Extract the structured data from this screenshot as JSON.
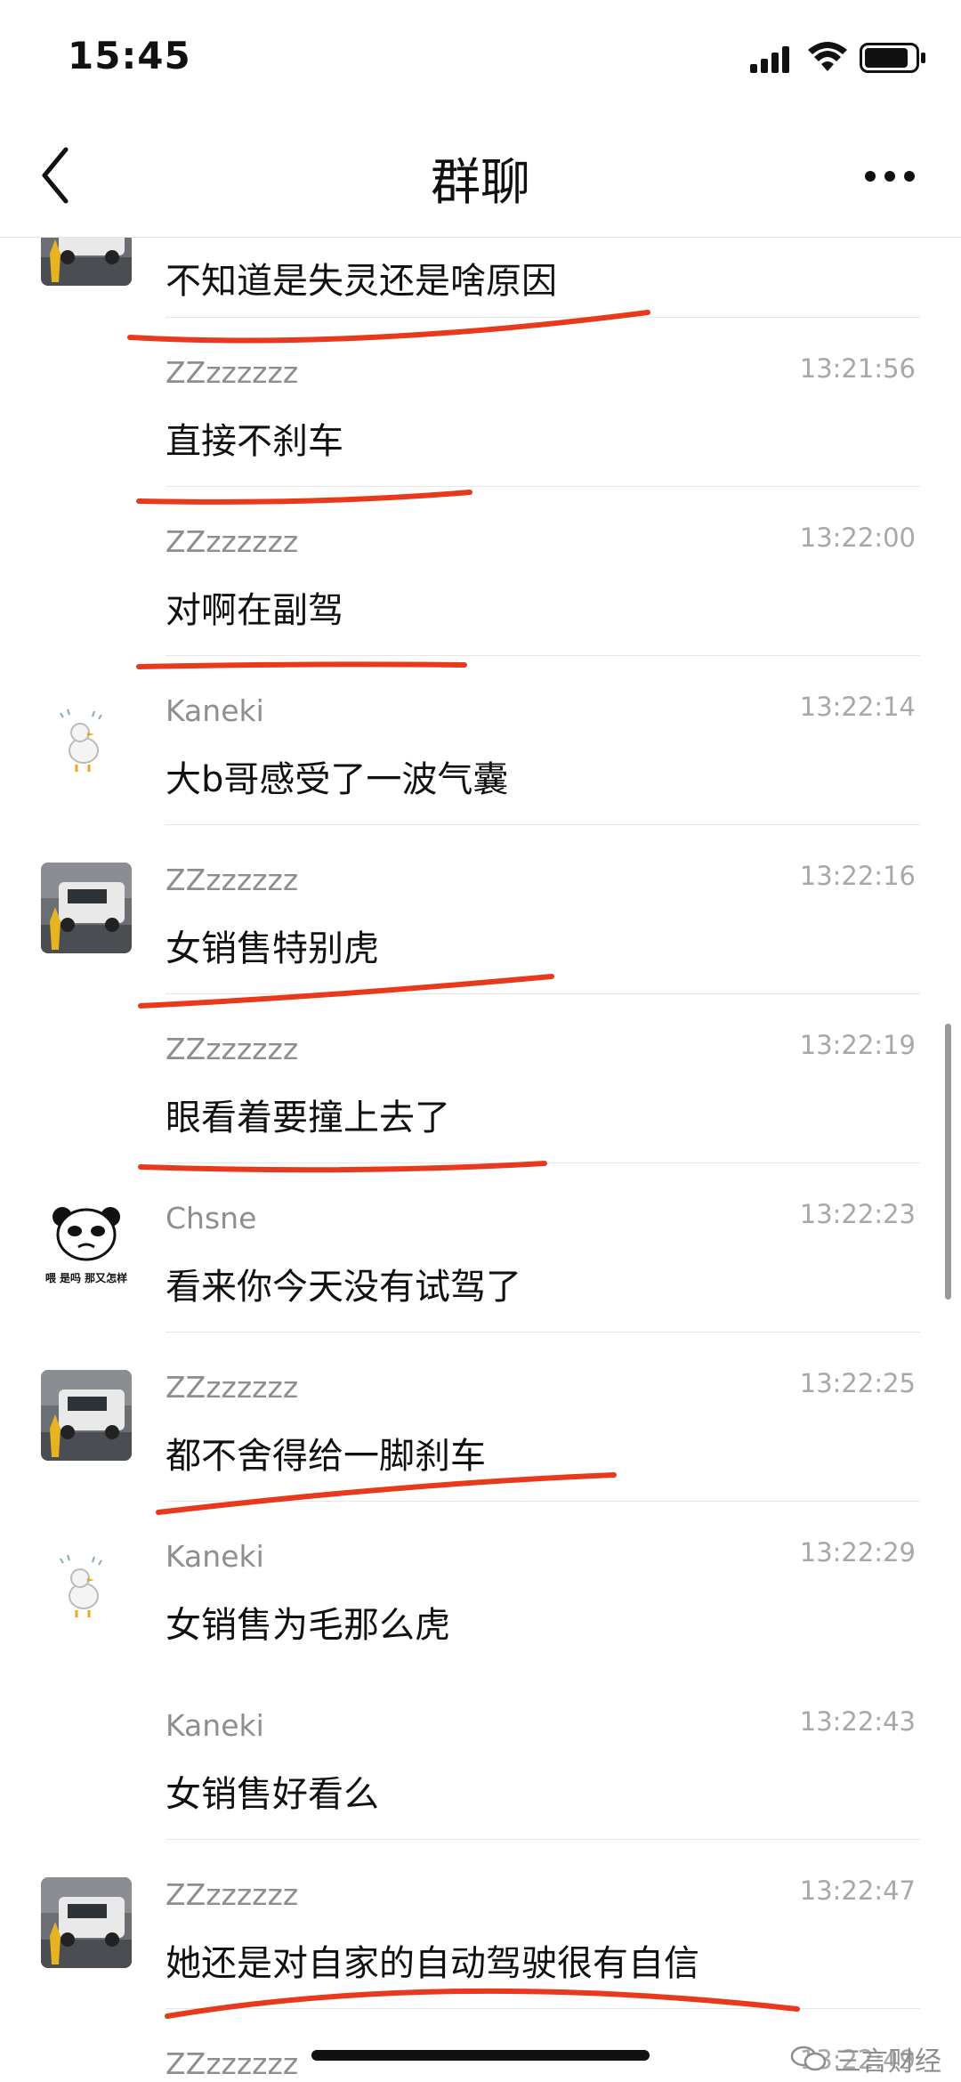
{
  "status_bar": {
    "time": "15:45"
  },
  "header": {
    "title": "群聊"
  },
  "messages": [
    {
      "sender": "",
      "time": "",
      "text": "不知道是失灵还是啥原因",
      "avatar": "van-photo"
    },
    {
      "sender": "ZZzzzzzz",
      "time": "13:21:56",
      "text": "直接不刹车",
      "avatar": ""
    },
    {
      "sender": "ZZzzzzzz",
      "time": "13:22:00",
      "text": "对啊在副驾",
      "avatar": ""
    },
    {
      "sender": "Kaneki",
      "time": "13:22:14",
      "text": "大b哥感受了一波气囊",
      "avatar": "duck-sticker"
    },
    {
      "sender": "ZZzzzzzz",
      "time": "13:22:16",
      "text": "女销售特别虎",
      "avatar": "van-photo"
    },
    {
      "sender": "ZZzzzzzz",
      "time": "13:22:19",
      "text": "眼看着要撞上去了",
      "avatar": ""
    },
    {
      "sender": "Chsne",
      "time": "13:22:23",
      "text": "看来你今天没有试驾了",
      "avatar": "panda-meme"
    },
    {
      "sender": "ZZzzzzzz",
      "time": "13:22:25",
      "text": "都不舍得给一脚刹车",
      "avatar": "van-photo"
    },
    {
      "sender": "Kaneki",
      "time": "13:22:29",
      "text": "女销售为毛那么虎",
      "avatar": "duck-sticker"
    },
    {
      "sender": "Kaneki",
      "time": "13:22:43",
      "text": "女销售好看么",
      "avatar": ""
    },
    {
      "sender": "ZZzzzzzz",
      "time": "13:22:47",
      "text": "她还是对自家的自动驾驶很有自信",
      "avatar": "van-photo"
    },
    {
      "sender": "ZZzzzzzz",
      "time": "13:22:49",
      "text": "",
      "avatar": ""
    }
  ],
  "avatar_text": {
    "panda_caption": "喂 是吗 那又怎样"
  },
  "watermark": {
    "text": "三言财经"
  },
  "colors": {
    "underline": "#e8391c",
    "divider": "#e6e6e6",
    "meta": "#a8a8a8"
  }
}
